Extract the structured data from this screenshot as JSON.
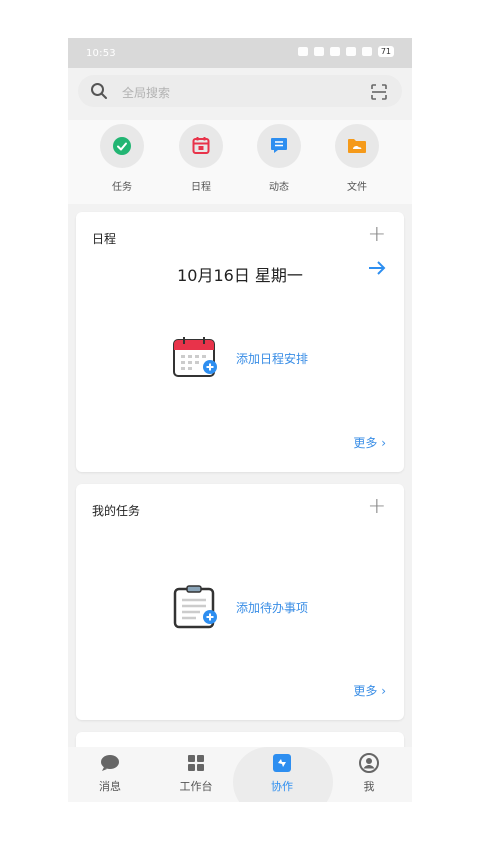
{
  "status_bar": {
    "time": "10:53",
    "battery": "71"
  },
  "search": {
    "placeholder": "全局搜索"
  },
  "quick_actions": [
    {
      "label": "任务",
      "icon": "check-circle-icon",
      "color": "#22b573"
    },
    {
      "label": "日程",
      "icon": "calendar-icon",
      "color": "#e8334a"
    },
    {
      "label": "动态",
      "icon": "chat-icon",
      "color": "#2d8ef0"
    },
    {
      "label": "文件",
      "icon": "folder-icon",
      "color": "#f59a1a"
    }
  ],
  "schedule_card": {
    "title": "日程",
    "date": "10月16日 星期一",
    "add_label": "添加日程安排",
    "more_label": "更多 ›"
  },
  "tasks_card": {
    "title": "我的任务",
    "add_label": "添加待办事项",
    "more_label": "更多 ›"
  },
  "bottom_nav": [
    {
      "label": "消息",
      "icon": "message-icon"
    },
    {
      "label": "工作台",
      "icon": "grid-icon"
    },
    {
      "label": "协作",
      "icon": "collaboration-icon",
      "active": true
    },
    {
      "label": "我",
      "icon": "profile-icon"
    }
  ],
  "colors": {
    "accent": "#2d8ef0",
    "link": "#3a8ee6"
  }
}
